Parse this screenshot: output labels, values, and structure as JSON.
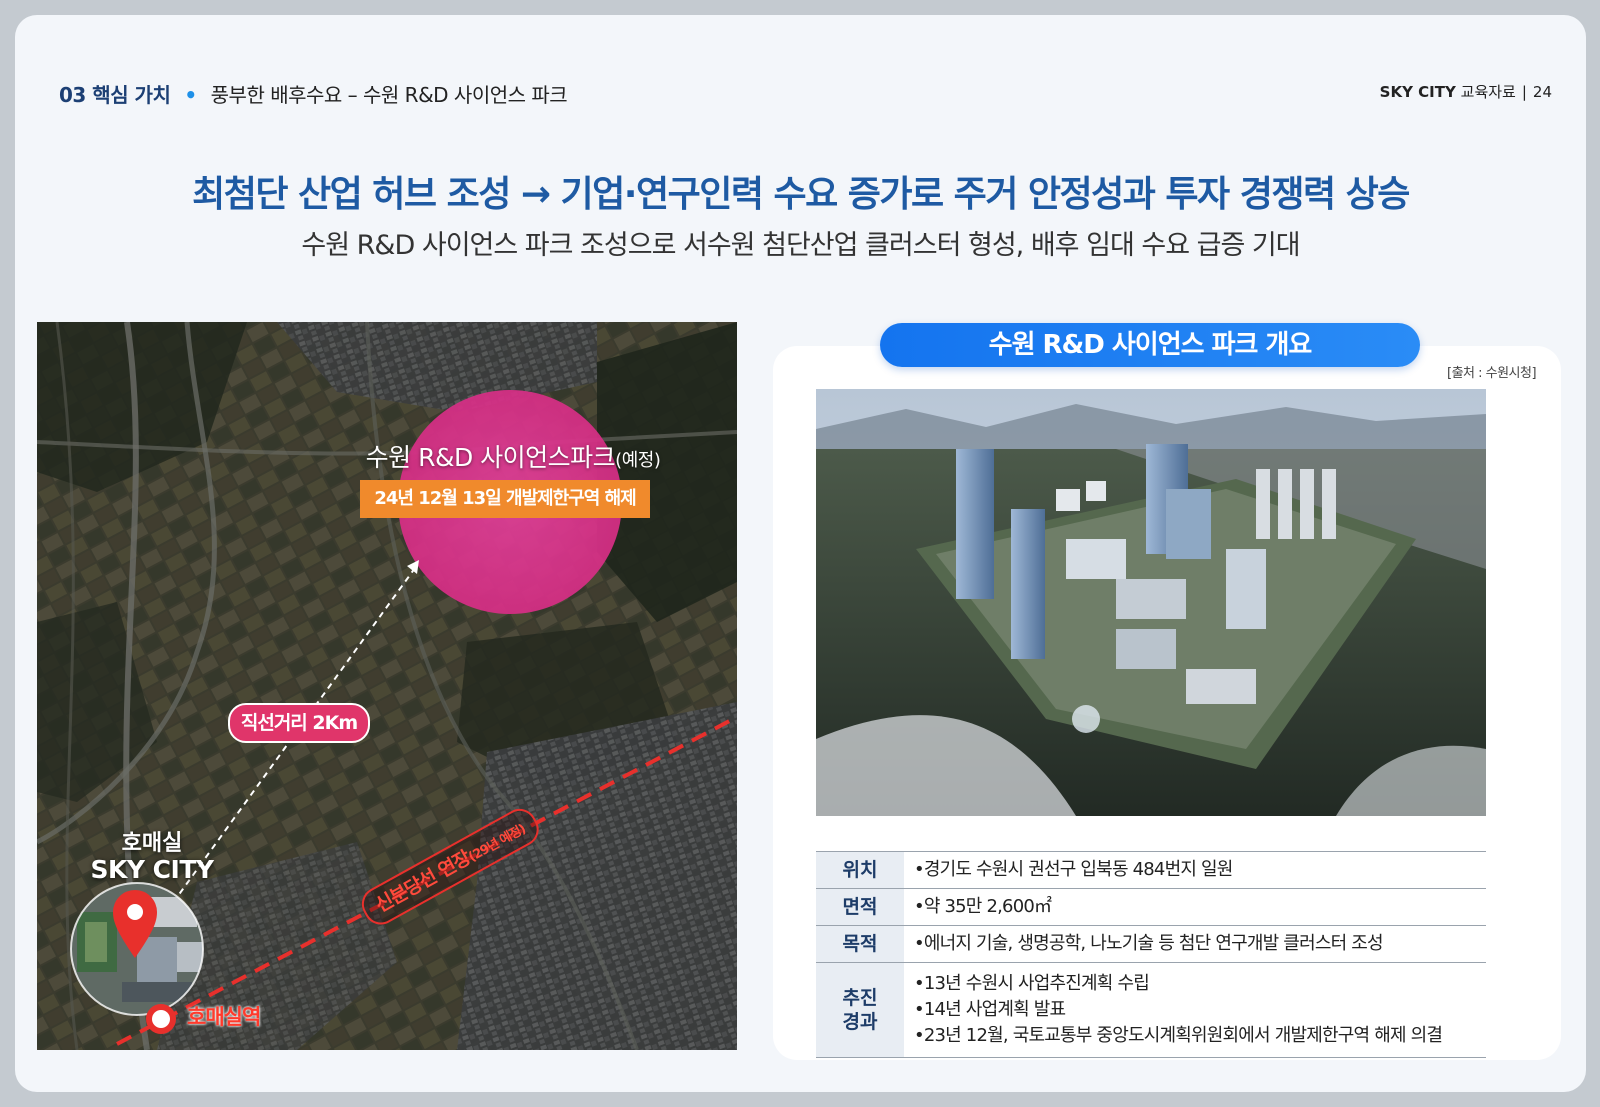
{
  "header": {
    "section": "03 핵심 가치",
    "bullet": "•",
    "topic": "풍부한 배후수요 – 수원 R&D 사이언스 파크",
    "brand": "SKY CITY",
    "doc_name": "교육자료",
    "separator": "|",
    "page_number": "24"
  },
  "headline": "최첨단 산업 허브 조성 → 기업·연구인력 수요 증가로 주거 안정성과 투자 경쟁력 상승",
  "subheadline": "수원 R&D 사이언스 파크 조성으로 서수원 첨단산업 클러스터 형성, 배후 임대 수요 급증 기대",
  "map": {
    "park_label": "수원 R&D 사이언스파크",
    "park_label_suffix": "(예정)",
    "park_badge": "24년 12월 13일 개발제한구역 해제",
    "distance_label": "직선거리 2Km",
    "site_name_line1": "호매실",
    "site_name_line2": "SKY CITY",
    "rail_label": "신분당선 연장",
    "rail_label_suffix": "(29년 예정)",
    "station_label": "호매실역",
    "colors": {
      "park_circle": "#e0348f",
      "badge": "#f08a2c",
      "distance_pill": "#e0356a",
      "rail_line": "#e8302c",
      "pin": "#e8302c"
    }
  },
  "overview": {
    "title": "수원 R&D 사이언스 파크 개요",
    "source": "[출처 : 수원시청]",
    "rows": [
      {
        "key": "위치",
        "lines": [
          "•경기도 수원시 권선구 입북동 484번지 일원"
        ]
      },
      {
        "key": "면적",
        "lines": [
          "•약 35만 2,600㎡"
        ]
      },
      {
        "key": "목적",
        "lines": [
          "•에너지 기술, 생명공학, 나노기술 등 첨단 연구개발 클러스터 조성"
        ]
      },
      {
        "key_line1": "추진",
        "key_line2": "경과",
        "lines": [
          "•13년 수원시 사업추진계획 수립",
          "•14년 사업계획 발표",
          "•23년 12월, 국토교통부 중앙도시계획위원회에서 개발제한구역 해제 의결"
        ]
      }
    ],
    "colors": {
      "pill": "#1a7cf0",
      "key_bg": "#e8edf3",
      "key_text": "#1d3c68"
    }
  }
}
